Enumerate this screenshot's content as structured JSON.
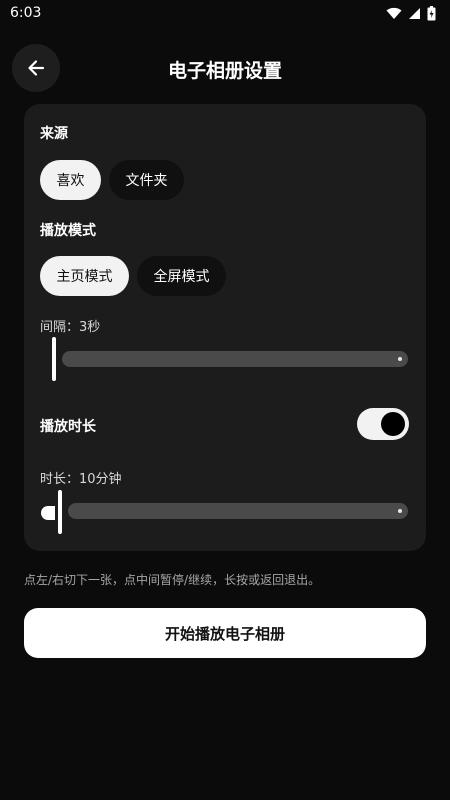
{
  "status_bar": {
    "time": "6:03",
    "icons": [
      "wifi-icon",
      "signal-icon",
      "battery-icon"
    ]
  },
  "header": {
    "back_icon": "arrow-left-icon",
    "title": "电子相册设置"
  },
  "source": {
    "label": "来源",
    "options": [
      {
        "label": "喜欢",
        "selected": true
      },
      {
        "label": "文件夹",
        "selected": false
      }
    ]
  },
  "play_mode": {
    "label": "播放模式",
    "options": [
      {
        "label": "主页模式",
        "selected": true
      },
      {
        "label": "全屏模式",
        "selected": false
      }
    ]
  },
  "interval": {
    "label": "间隔：3秒",
    "value_seconds": 3,
    "slider_position": 0.0
  },
  "play_duration": {
    "label": "播放时长",
    "enabled": true
  },
  "duration": {
    "label": "时长：10分钟",
    "value_minutes": 10,
    "slider_position": 0.0
  },
  "hint": "点左/右切下一张，点中间暂停/继续，长按或返回退出。",
  "start_button": "开始播放电子相册",
  "colors": {
    "background": "#0b0b0b",
    "card": "#1c1c1c",
    "chip_selected": "#f2f2f2",
    "chip_unselected": "#101010",
    "track": "#4a4a4a",
    "button": "#ffffff"
  }
}
